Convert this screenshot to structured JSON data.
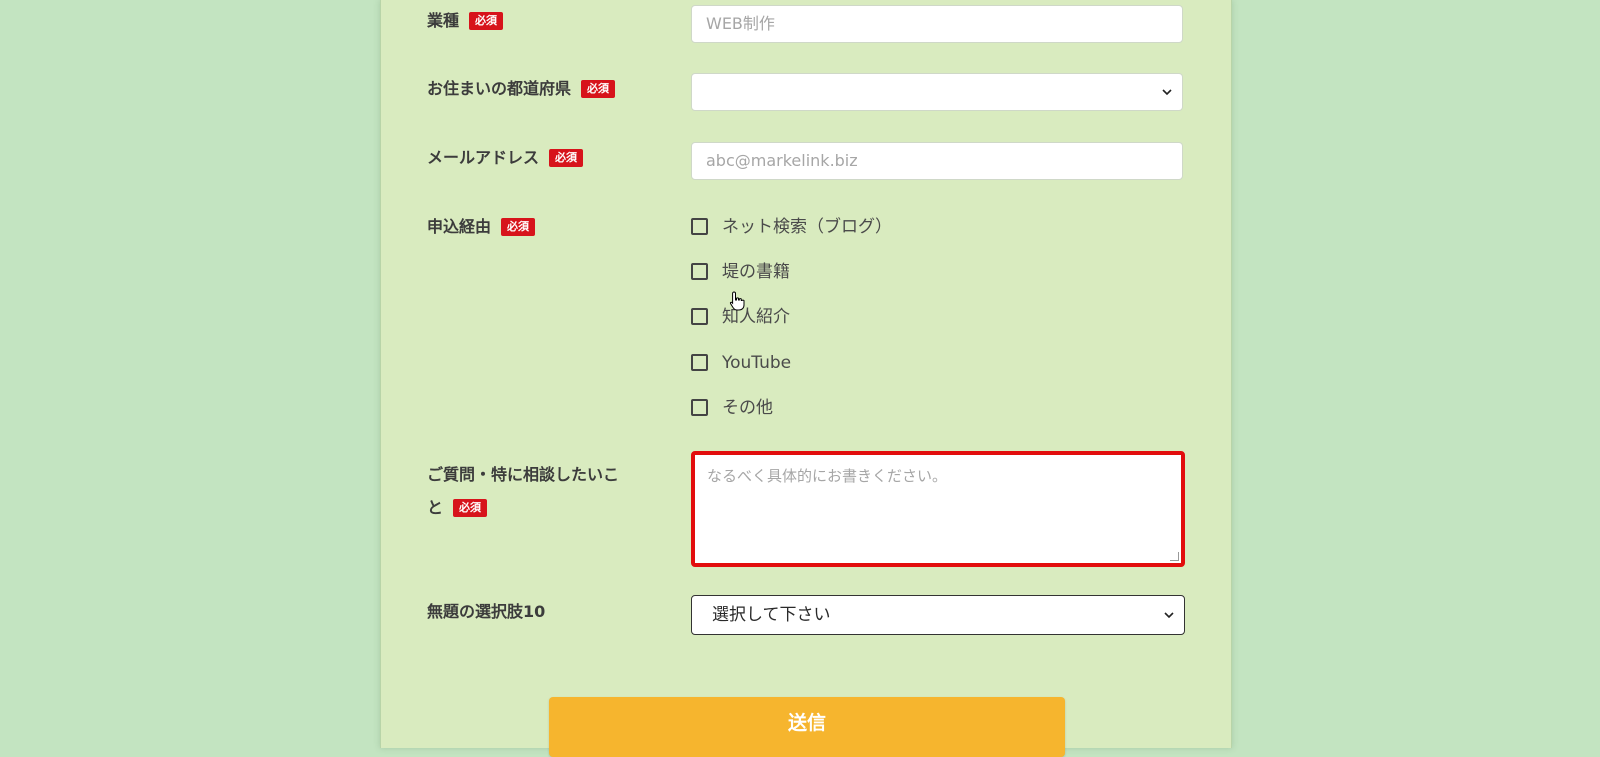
{
  "required_badge": "必須",
  "fields": {
    "industry": {
      "label": "業種",
      "placeholder": "WEB制作"
    },
    "prefecture": {
      "label": "お住まいの都道府県",
      "value": ""
    },
    "email": {
      "label": "メールアドレス",
      "placeholder": "abc@markelink.biz"
    },
    "source": {
      "label": "申込経由",
      "options": [
        "ネット検索（ブログ）",
        "堤の書籍",
        "知人紹介",
        "YouTube",
        "その他"
      ]
    },
    "question": {
      "label_line1": "ご質問・特に相談したいこ",
      "label_line2": "と",
      "placeholder": "なるべく具体的にお書きください。"
    },
    "choice10": {
      "label": "無題の選択肢10",
      "value": "選択して下さい"
    }
  },
  "submit_label": "送信",
  "colors": {
    "background": "#c3e4c1",
    "panel": "#d9ebbf",
    "badge": "#d7131b",
    "textarea_border": "#e20d0d",
    "submit": "#f6b52e"
  },
  "icons": {
    "chevron": "chevron-down-icon",
    "cursor": "hand-pointer-icon"
  }
}
